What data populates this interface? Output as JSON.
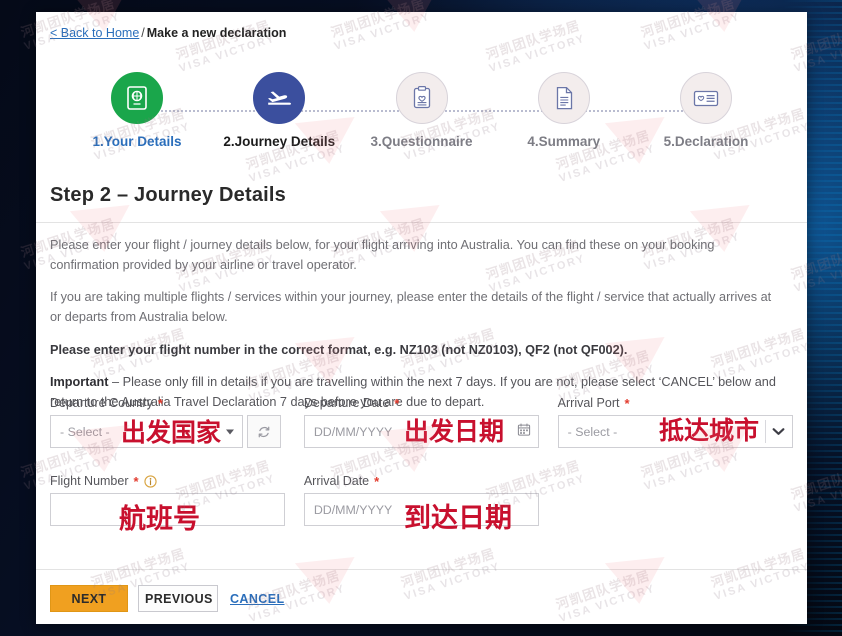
{
  "breadcrumb": {
    "back_link": "< Back to Home",
    "separator": "/",
    "current": "Make a new declaration"
  },
  "stepper": {
    "steps": [
      {
        "label": "1.Your Details",
        "icon": "passport-icon",
        "state": "done"
      },
      {
        "label": "2.Journey Details",
        "icon": "airplane-icon",
        "state": "active"
      },
      {
        "label": "3.Questionnaire",
        "icon": "clipboard-heart-icon",
        "state": "upcoming"
      },
      {
        "label": "4.Summary",
        "icon": "document-icon",
        "state": "upcoming"
      },
      {
        "label": "5.Declaration",
        "icon": "id-card-heart-icon",
        "state": "upcoming"
      }
    ]
  },
  "page": {
    "title": "Step 2 – Journey Details",
    "paragraphs": {
      "p1": "Please enter your flight / journey details below, for your flight arriving into Australia. You can find these on your booking confirmation provided by your airline or travel operator.",
      "p2": "If you are taking multiple flights / services within your journey, please enter the details of the flight / service that actually arrives at or departs from Australia below.",
      "p3": "Please enter your flight number in the correct format, e.g. NZ103 (not NZ0103), QF2 (not QF002).",
      "p4_strong": "Important",
      "p4_rest": " – Please only fill in details if you are travelling within the next 7 days.  If you are not, please select ‘CANCEL’ below and return to the Australia Travel Declaration 7 days before you are due to depart."
    }
  },
  "form": {
    "departure_country": {
      "label": "Departure Country",
      "required_mark": "*",
      "value": "- Select -",
      "annotation": "出发国家",
      "refresh_icon": "refresh-icon"
    },
    "departure_date": {
      "label": "Departure Date",
      "required_mark": "*",
      "placeholder": "DD/MM/YYYY",
      "annotation": "出发日期",
      "calendar_icon": "calendar-icon"
    },
    "arrival_port": {
      "label": "Arrival Port",
      "required_mark": "*",
      "value": "- Select -",
      "annotation": "抵达城市",
      "chevron_icon": "chevron-down-icon"
    },
    "flight_number": {
      "label": "Flight Number",
      "required_mark": "*",
      "info_icon": "info-icon",
      "placeholder": "",
      "annotation": "航班号"
    },
    "arrival_date": {
      "label": "Arrival Date",
      "required_mark": "*",
      "placeholder": "DD/MM/YYYY",
      "annotation": "到达日期"
    }
  },
  "actions": {
    "next": "NEXT",
    "previous": "PREVIOUS",
    "cancel": "CANCEL"
  },
  "watermark": {
    "line1": "河凯团队学场居",
    "line2": "VISA VICTORY"
  },
  "colors": {
    "accent_orange": "#f0a020",
    "link_blue": "#2a6ebb",
    "step_done_green": "#1aa64b",
    "step_active_blue": "#3b4f9e",
    "required_red": "#e23b2e",
    "annotation_red": "#c8102e",
    "page_backdrop": "#050a18"
  }
}
